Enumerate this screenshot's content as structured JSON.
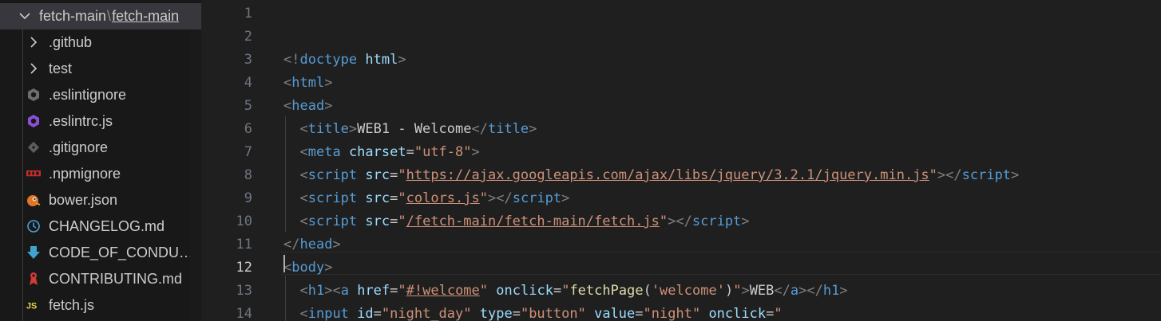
{
  "explorer": {
    "root_folder": "fetch-main",
    "root_separator": "\\",
    "root_subfolder": "fetch-main",
    "items": [
      {
        "label": ".github",
        "kind": "folder",
        "icon": "chevron-right-icon"
      },
      {
        "label": "test",
        "kind": "folder",
        "icon": "chevron-right-icon"
      },
      {
        "label": ".eslintignore",
        "kind": "file",
        "icon": "eslint-ignore-icon"
      },
      {
        "label": ".eslintrc.js",
        "kind": "file",
        "icon": "eslint-icon"
      },
      {
        "label": ".gitignore",
        "kind": "file",
        "icon": "git-icon"
      },
      {
        "label": ".npmignore",
        "kind": "file",
        "icon": "npm-icon"
      },
      {
        "label": "bower.json",
        "kind": "file",
        "icon": "bower-icon"
      },
      {
        "label": "CHANGELOG.md",
        "kind": "file",
        "icon": "changelog-icon"
      },
      {
        "label": "CODE_OF_CONDUCT.md",
        "kind": "file",
        "icon": "download-arrow-icon"
      },
      {
        "label": "CONTRIBUTING.md",
        "kind": "file",
        "icon": "contributing-icon"
      },
      {
        "label": "fetch.js",
        "kind": "file",
        "icon": "js-icon"
      }
    ]
  },
  "editor": {
    "active_line": 12,
    "lines": [
      {
        "n": "1",
        "tokens": []
      },
      {
        "n": "2",
        "tokens": []
      },
      {
        "n": "3",
        "tokens": [
          {
            "t": "<!",
            "c": "punct"
          },
          {
            "t": "doctype",
            "c": "tag"
          },
          {
            "t": " ",
            "c": "text"
          },
          {
            "t": "html",
            "c": "attr"
          },
          {
            "t": ">",
            "c": "punct"
          }
        ]
      },
      {
        "n": "4",
        "tokens": [
          {
            "t": "<",
            "c": "punct"
          },
          {
            "t": "html",
            "c": "tag"
          },
          {
            "t": ">",
            "c": "punct"
          }
        ]
      },
      {
        "n": "5",
        "tokens": [
          {
            "t": "<",
            "c": "punct"
          },
          {
            "t": "head",
            "c": "tag"
          },
          {
            "t": ">",
            "c": "punct"
          }
        ]
      },
      {
        "n": "6",
        "tokens": [
          {
            "t": "  ",
            "c": "text"
          },
          {
            "t": "<",
            "c": "punct"
          },
          {
            "t": "title",
            "c": "tag"
          },
          {
            "t": ">",
            "c": "punct"
          },
          {
            "t": "WEB1 - Welcome",
            "c": "text"
          },
          {
            "t": "</",
            "c": "punct"
          },
          {
            "t": "title",
            "c": "tag"
          },
          {
            "t": ">",
            "c": "punct"
          }
        ]
      },
      {
        "n": "7",
        "tokens": [
          {
            "t": "  ",
            "c": "text"
          },
          {
            "t": "<",
            "c": "punct"
          },
          {
            "t": "meta",
            "c": "tag"
          },
          {
            "t": " ",
            "c": "text"
          },
          {
            "t": "charset",
            "c": "attr"
          },
          {
            "t": "=",
            "c": "text"
          },
          {
            "t": "\"utf-8\"",
            "c": "str"
          },
          {
            "t": ">",
            "c": "punct"
          }
        ]
      },
      {
        "n": "8",
        "tokens": [
          {
            "t": "  ",
            "c": "text"
          },
          {
            "t": "<",
            "c": "punct"
          },
          {
            "t": "script",
            "c": "tag"
          },
          {
            "t": " ",
            "c": "text"
          },
          {
            "t": "src",
            "c": "attr"
          },
          {
            "t": "=",
            "c": "text"
          },
          {
            "t": "\"",
            "c": "str"
          },
          {
            "t": "https://ajax.googleapis.com/ajax/libs/jquery/3.2.1/jquery.min.js",
            "c": "link"
          },
          {
            "t": "\"",
            "c": "str"
          },
          {
            "t": "></",
            "c": "punct"
          },
          {
            "t": "script",
            "c": "tag"
          },
          {
            "t": ">",
            "c": "punct"
          }
        ]
      },
      {
        "n": "9",
        "tokens": [
          {
            "t": "  ",
            "c": "text"
          },
          {
            "t": "<",
            "c": "punct"
          },
          {
            "t": "script",
            "c": "tag"
          },
          {
            "t": " ",
            "c": "text"
          },
          {
            "t": "src",
            "c": "attr"
          },
          {
            "t": "=",
            "c": "text"
          },
          {
            "t": "\"",
            "c": "str"
          },
          {
            "t": "colors.js",
            "c": "link"
          },
          {
            "t": "\"",
            "c": "str"
          },
          {
            "t": "></",
            "c": "punct"
          },
          {
            "t": "script",
            "c": "tag"
          },
          {
            "t": ">",
            "c": "punct"
          }
        ]
      },
      {
        "n": "10",
        "tokens": [
          {
            "t": "  ",
            "c": "text"
          },
          {
            "t": "<",
            "c": "punct"
          },
          {
            "t": "script",
            "c": "tag"
          },
          {
            "t": " ",
            "c": "text"
          },
          {
            "t": "src",
            "c": "attr"
          },
          {
            "t": "=",
            "c": "text"
          },
          {
            "t": "\"",
            "c": "str"
          },
          {
            "t": "/fetch-main/fetch-main/fetch.js",
            "c": "link"
          },
          {
            "t": "\"",
            "c": "str"
          },
          {
            "t": "></",
            "c": "punct"
          },
          {
            "t": "script",
            "c": "tag"
          },
          {
            "t": ">",
            "c": "punct"
          }
        ]
      },
      {
        "n": "11",
        "tokens": [
          {
            "t": "</",
            "c": "punct"
          },
          {
            "t": "head",
            "c": "tag"
          },
          {
            "t": ">",
            "c": "punct"
          }
        ]
      },
      {
        "n": "12",
        "tokens": [
          {
            "t": "<",
            "c": "punct"
          },
          {
            "t": "body",
            "c": "tag"
          },
          {
            "t": ">",
            "c": "punct"
          }
        ]
      },
      {
        "n": "13",
        "tokens": [
          {
            "t": "  ",
            "c": "text"
          },
          {
            "t": "<",
            "c": "punct"
          },
          {
            "t": "h1",
            "c": "tag"
          },
          {
            "t": "><",
            "c": "punct"
          },
          {
            "t": "a",
            "c": "tag"
          },
          {
            "t": " ",
            "c": "text"
          },
          {
            "t": "href",
            "c": "attr"
          },
          {
            "t": "=",
            "c": "text"
          },
          {
            "t": "\"",
            "c": "str"
          },
          {
            "t": "#!welcome",
            "c": "link"
          },
          {
            "t": "\"",
            "c": "str"
          },
          {
            "t": " ",
            "c": "text"
          },
          {
            "t": "onclick",
            "c": "attr"
          },
          {
            "t": "=",
            "c": "text"
          },
          {
            "t": "\"",
            "c": "str"
          },
          {
            "t": "fetchPage",
            "c": "fn"
          },
          {
            "t": "(",
            "c": "text"
          },
          {
            "t": "'welcome'",
            "c": "str"
          },
          {
            "t": ")",
            "c": "text"
          },
          {
            "t": "\"",
            "c": "str"
          },
          {
            "t": ">",
            "c": "punct"
          },
          {
            "t": "WEB",
            "c": "text"
          },
          {
            "t": "</",
            "c": "punct"
          },
          {
            "t": "a",
            "c": "tag"
          },
          {
            "t": "></",
            "c": "punct"
          },
          {
            "t": "h1",
            "c": "tag"
          },
          {
            "t": ">",
            "c": "punct"
          }
        ]
      },
      {
        "n": "14",
        "tokens": [
          {
            "t": "  ",
            "c": "text"
          },
          {
            "t": "<",
            "c": "punct"
          },
          {
            "t": "input",
            "c": "tag"
          },
          {
            "t": " ",
            "c": "text"
          },
          {
            "t": "id",
            "c": "attr"
          },
          {
            "t": "=",
            "c": "text"
          },
          {
            "t": "\"night_day\"",
            "c": "str"
          },
          {
            "t": " ",
            "c": "text"
          },
          {
            "t": "type",
            "c": "attr"
          },
          {
            "t": "=",
            "c": "text"
          },
          {
            "t": "\"button\"",
            "c": "str"
          },
          {
            "t": " ",
            "c": "text"
          },
          {
            "t": "value",
            "c": "attr"
          },
          {
            "t": "=",
            "c": "text"
          },
          {
            "t": "\"night\"",
            "c": "str"
          },
          {
            "t": " ",
            "c": "text"
          },
          {
            "t": "onclick",
            "c": "attr"
          },
          {
            "t": "=",
            "c": "text"
          },
          {
            "t": "\"",
            "c": "str"
          }
        ]
      }
    ]
  }
}
